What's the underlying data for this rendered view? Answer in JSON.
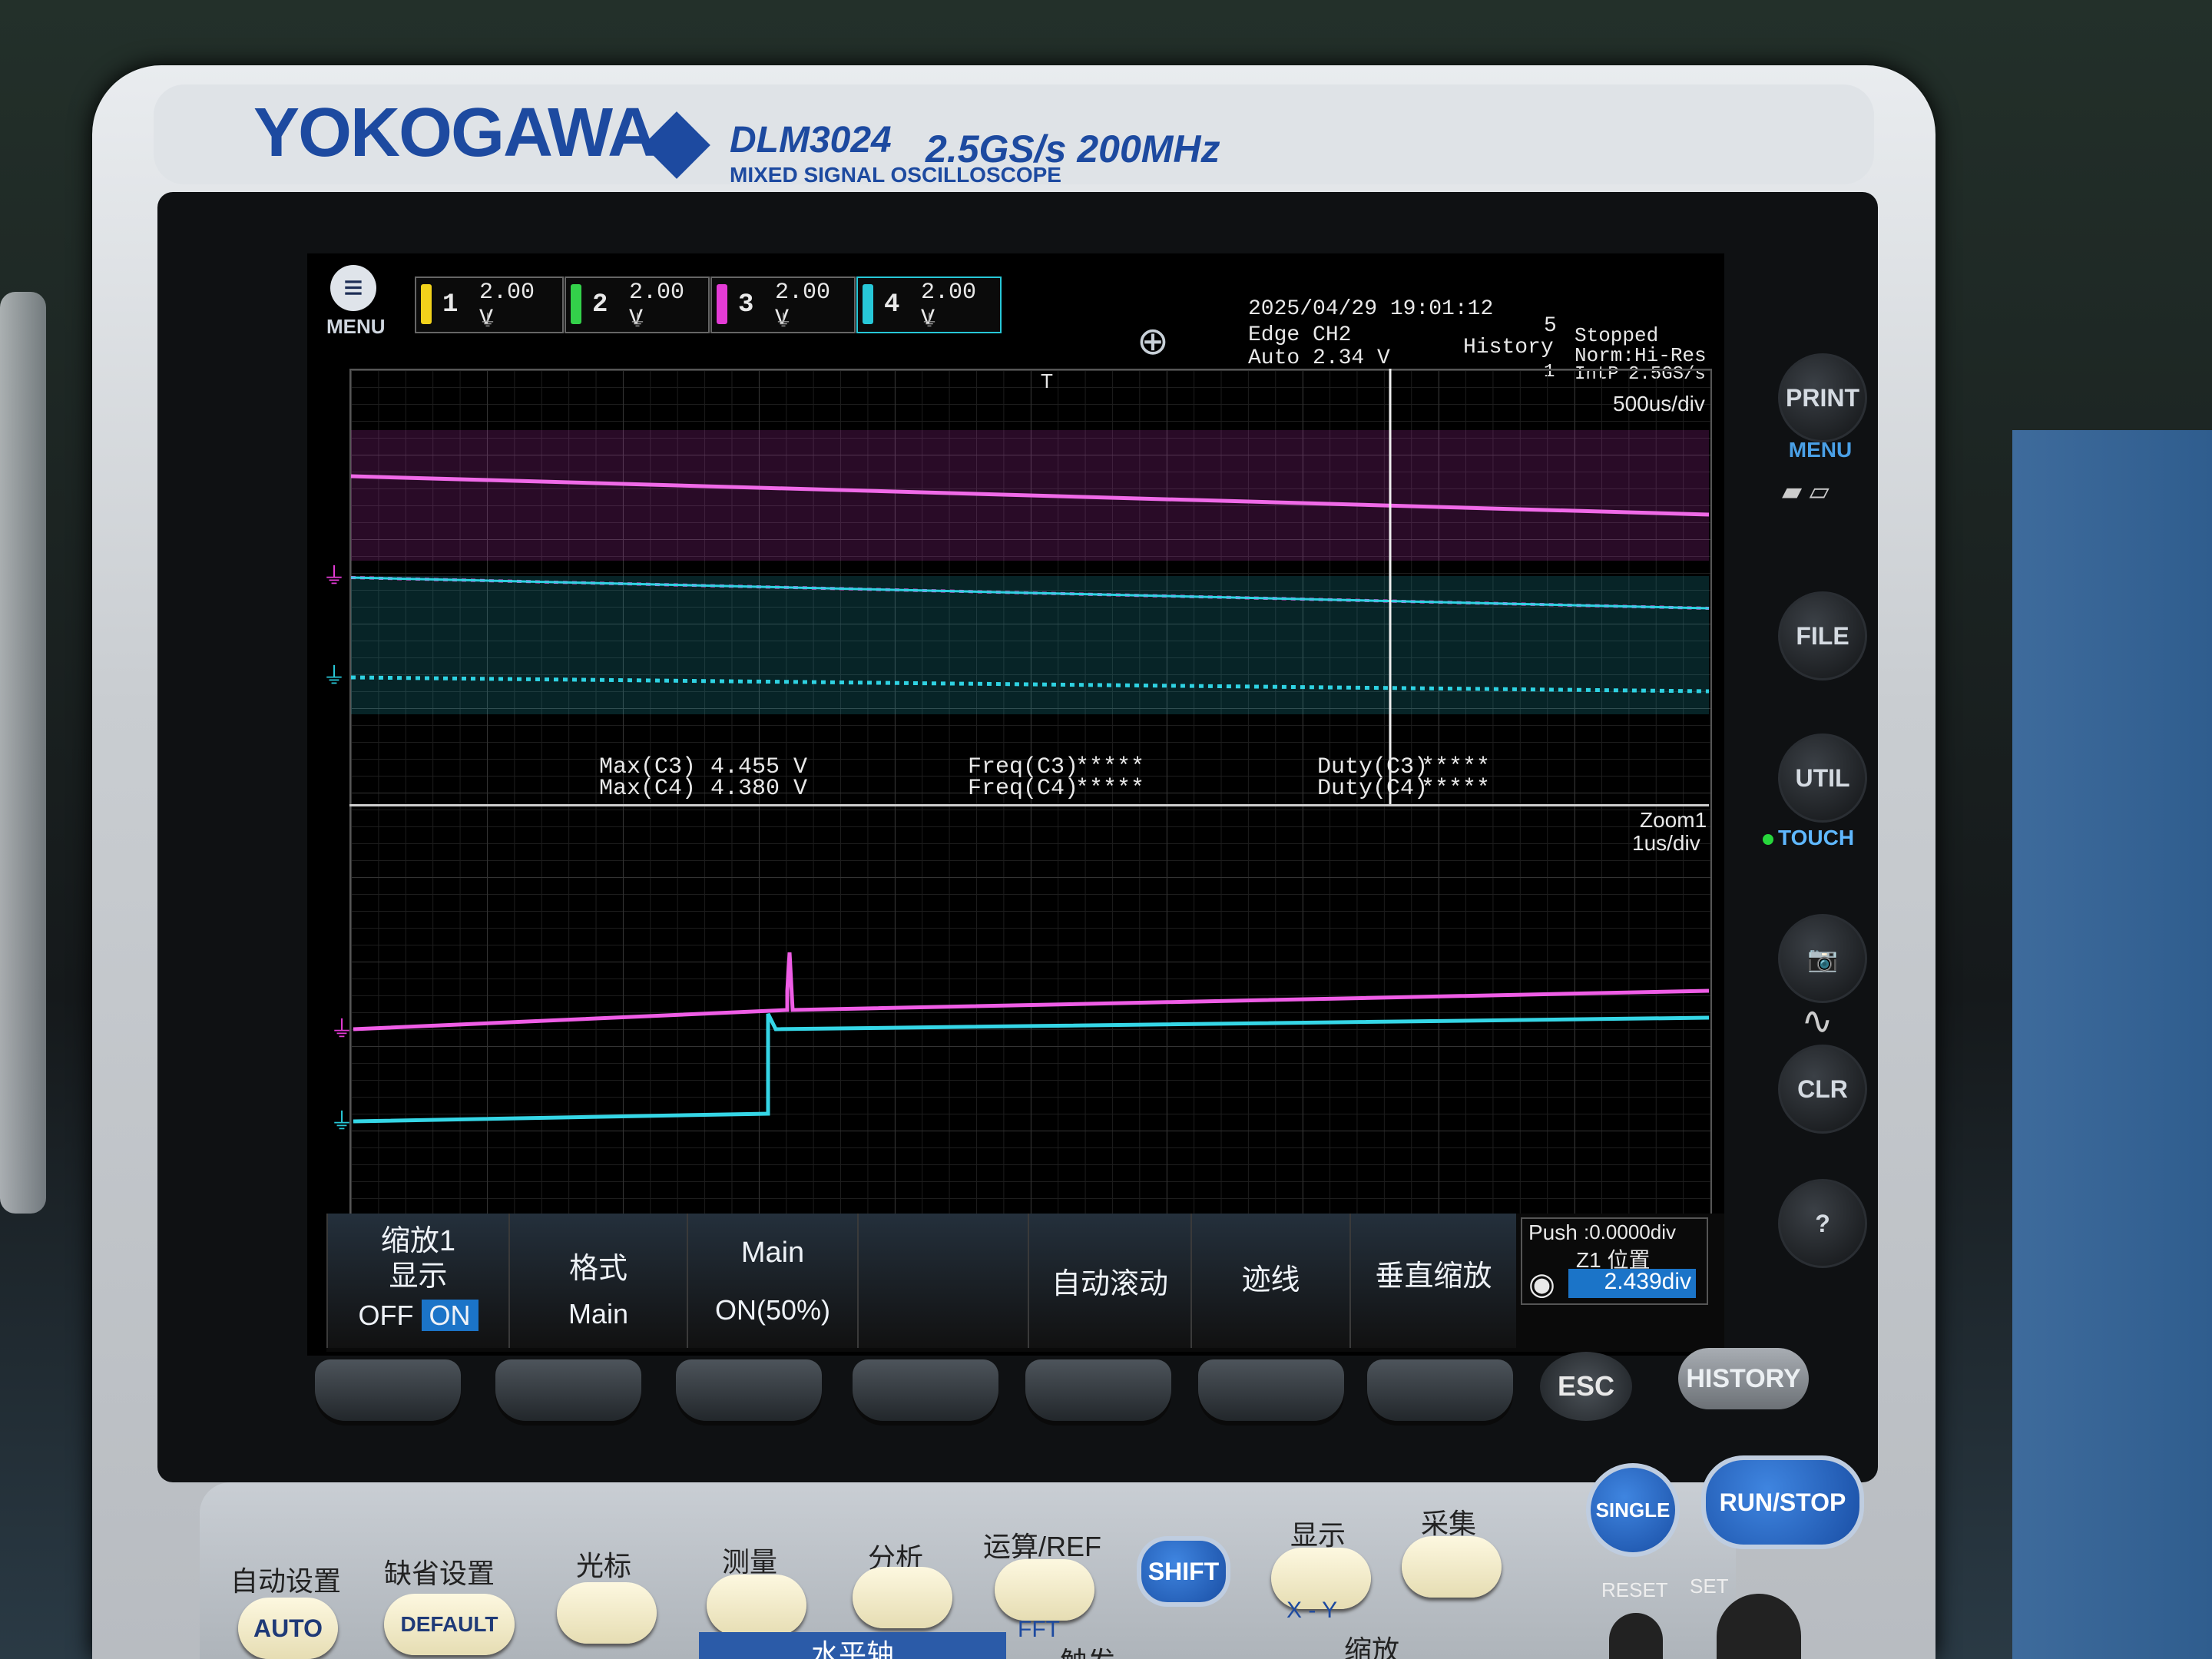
{
  "device": {
    "brand": "YOKOGAWA",
    "model": "DLM3024",
    "spec": "2.5GS/s 200MHz",
    "subtitle": "MIXED SIGNAL OSCILLOSCOPE"
  },
  "topbar": {
    "menu_label": "MENU",
    "channels": [
      {
        "num": "1",
        "volts": "2.00 V",
        "color": "#f2d21b"
      },
      {
        "num": "2",
        "volts": "2.00 V",
        "color": "#33d14a"
      },
      {
        "num": "3",
        "volts": "2.00 V",
        "color": "#e43bd6"
      },
      {
        "num": "4",
        "volts": "2.00 V",
        "color": "#27c8d8"
      }
    ],
    "datetime": "2025/04/29 19:01:12",
    "trigger_type": "Edge CH2",
    "trigger_mode": "Auto 2.34 V",
    "history_label": "History",
    "history_count": "5",
    "history_index": "1",
    "acq_mode": "Norm:Hi-Res",
    "interp": "IntP",
    "sample_rate": "2.5GS/s",
    "state": "Stopped",
    "timebase": "500us/div"
  },
  "measurements": {
    "max_c3_label": "Max(C3)",
    "max_c3_value": "4.455 V",
    "max_c4_label": "Max(C4)",
    "max_c4_value": "4.380 V",
    "freq_c3_label": "Freq(C3)",
    "freq_c3_value": "*****",
    "freq_c4_label": "Freq(C4)",
    "freq_c4_value": "*****",
    "duty_c3_label": "Duty(C3)",
    "duty_c3_value": "*****",
    "duty_c4_label": "Duty(C4)",
    "duty_c4_value": "*****"
  },
  "zoom": {
    "label": "Zoom1",
    "timebase": "1us/div"
  },
  "softkeys": {
    "zoom_title": "缩放1",
    "display_label": "显示",
    "off_label": "OFF",
    "on_label": "ON",
    "format_label": "格式",
    "format_value": "Main",
    "main_label": "Main",
    "main_value": "ON(50%)",
    "autoscroll_label": "自动滚动",
    "trace_label": "迹线",
    "vzoom_label": "垂直缩放",
    "push_label": "Push",
    "push_value": ":0.0000div",
    "z1_pos_label": "Z1 位置",
    "z1_pos_value": "2.439",
    "z1_pos_unit": "div"
  },
  "right_panel": {
    "print": "PRINT",
    "menu": "MENU",
    "file": "FILE",
    "util": "UTIL",
    "touch": "TOUCH",
    "clr": "CLR",
    "help": "?"
  },
  "function_keys": {
    "esc": "ESC",
    "history": "HISTORY"
  },
  "control_panel": {
    "auto_setup": "自动设置",
    "default_setup": "缺省设置",
    "cursor": "光标",
    "measure": "测量",
    "analysis": "分析",
    "math_ref": "运算/REF",
    "display": "显示",
    "acquire": "采集",
    "auto_btn": "AUTO",
    "default_btn": "DEFAULT",
    "shift": "SHIFT",
    "fft": "FFT",
    "xy": "X - Y",
    "horizontal": "水平轴",
    "trigger": "触发",
    "zoom": "缩放",
    "single": "SINGLE",
    "run_stop": "RUN/STOP",
    "reset": "RESET",
    "set": "SET"
  }
}
